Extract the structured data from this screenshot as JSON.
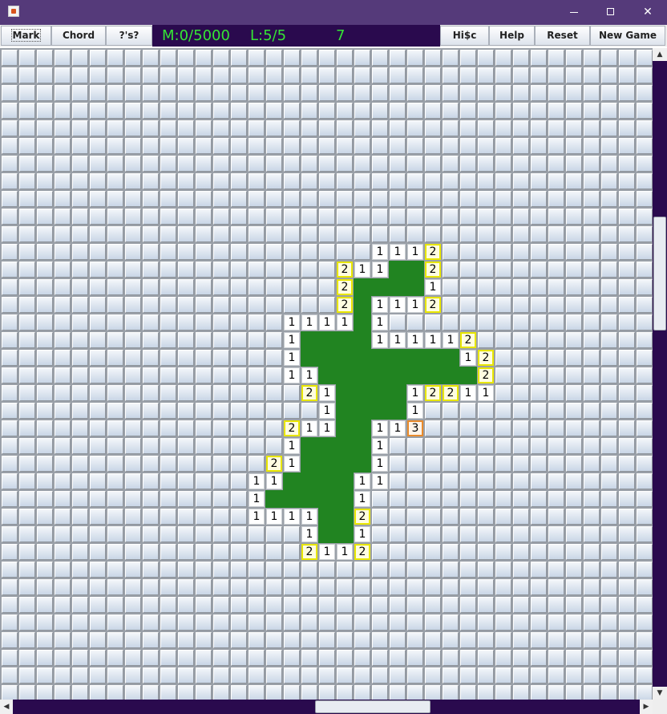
{
  "window": {
    "icon": "java-cup-icon",
    "controls": {
      "minimize": "minimize-icon",
      "maximize": "maximize-icon",
      "close": "✕"
    }
  },
  "toolbar": {
    "mark": "Mark",
    "chord": "Chord",
    "questions": "?'s?",
    "hisc": "Hi$c",
    "help": "Help",
    "reset": "Reset",
    "new_game": "New Game"
  },
  "status": {
    "mines": "M:0/5000",
    "lives": "L:5/5",
    "count": "7"
  },
  "colors": {
    "title_bar": "#553a7a",
    "status_bg": "#2a0a4e",
    "status_text": "#35e535",
    "revealed_empty": "#218421",
    "hint_border": "#e8e600",
    "hot_border": "#e88a2a"
  },
  "board": {
    "cols": 37,
    "rows": 37,
    "revealed": [
      {
        "r": 11,
        "c": 21,
        "v": "1"
      },
      {
        "r": 11,
        "c": 22,
        "v": "1"
      },
      {
        "r": 11,
        "c": 23,
        "v": "1"
      },
      {
        "r": 11,
        "c": 24,
        "v": "2",
        "s": "hint"
      },
      {
        "r": 12,
        "c": 19,
        "v": "2",
        "s": "hint"
      },
      {
        "r": 12,
        "c": 20,
        "v": "1"
      },
      {
        "r": 12,
        "c": 21,
        "v": "1"
      },
      {
        "r": 12,
        "c": 22,
        "v": ""
      },
      {
        "r": 12,
        "c": 23,
        "v": ""
      },
      {
        "r": 12,
        "c": 24,
        "v": "2",
        "s": "hint"
      },
      {
        "r": 13,
        "c": 19,
        "v": "2",
        "s": "hint"
      },
      {
        "r": 13,
        "c": 20,
        "v": ""
      },
      {
        "r": 13,
        "c": 21,
        "v": ""
      },
      {
        "r": 13,
        "c": 22,
        "v": ""
      },
      {
        "r": 13,
        "c": 23,
        "v": ""
      },
      {
        "r": 13,
        "c": 24,
        "v": "1"
      },
      {
        "r": 14,
        "c": 19,
        "v": "2",
        "s": "hint"
      },
      {
        "r": 14,
        "c": 20,
        "v": ""
      },
      {
        "r": 14,
        "c": 21,
        "v": "1"
      },
      {
        "r": 14,
        "c": 22,
        "v": "1"
      },
      {
        "r": 14,
        "c": 23,
        "v": "1"
      },
      {
        "r": 14,
        "c": 24,
        "v": "2",
        "s": "hint"
      },
      {
        "r": 15,
        "c": 16,
        "v": "1"
      },
      {
        "r": 15,
        "c": 17,
        "v": "1"
      },
      {
        "r": 15,
        "c": 18,
        "v": "1"
      },
      {
        "r": 15,
        "c": 19,
        "v": "1"
      },
      {
        "r": 15,
        "c": 20,
        "v": ""
      },
      {
        "r": 15,
        "c": 21,
        "v": "1"
      },
      {
        "r": 16,
        "c": 16,
        "v": "1"
      },
      {
        "r": 16,
        "c": 17,
        "v": ""
      },
      {
        "r": 16,
        "c": 18,
        "v": ""
      },
      {
        "r": 16,
        "c": 19,
        "v": ""
      },
      {
        "r": 16,
        "c": 20,
        "v": ""
      },
      {
        "r": 16,
        "c": 21,
        "v": "1"
      },
      {
        "r": 16,
        "c": 22,
        "v": "1"
      },
      {
        "r": 16,
        "c": 23,
        "v": "1"
      },
      {
        "r": 16,
        "c": 24,
        "v": "1"
      },
      {
        "r": 16,
        "c": 25,
        "v": "1"
      },
      {
        "r": 16,
        "c": 26,
        "v": "2",
        "s": "hint"
      },
      {
        "r": 17,
        "c": 16,
        "v": "1"
      },
      {
        "r": 17,
        "c": 17,
        "v": ""
      },
      {
        "r": 17,
        "c": 18,
        "v": ""
      },
      {
        "r": 17,
        "c": 19,
        "v": ""
      },
      {
        "r": 17,
        "c": 20,
        "v": ""
      },
      {
        "r": 17,
        "c": 21,
        "v": ""
      },
      {
        "r": 17,
        "c": 22,
        "v": ""
      },
      {
        "r": 17,
        "c": 23,
        "v": ""
      },
      {
        "r": 17,
        "c": 24,
        "v": ""
      },
      {
        "r": 17,
        "c": 25,
        "v": ""
      },
      {
        "r": 17,
        "c": 26,
        "v": "1"
      },
      {
        "r": 17,
        "c": 27,
        "v": "2",
        "s": "hint"
      },
      {
        "r": 18,
        "c": 16,
        "v": "1"
      },
      {
        "r": 18,
        "c": 17,
        "v": "1"
      },
      {
        "r": 18,
        "c": 18,
        "v": ""
      },
      {
        "r": 18,
        "c": 19,
        "v": ""
      },
      {
        "r": 18,
        "c": 20,
        "v": ""
      },
      {
        "r": 18,
        "c": 21,
        "v": ""
      },
      {
        "r": 18,
        "c": 22,
        "v": ""
      },
      {
        "r": 18,
        "c": 23,
        "v": ""
      },
      {
        "r": 18,
        "c": 24,
        "v": ""
      },
      {
        "r": 18,
        "c": 25,
        "v": ""
      },
      {
        "r": 18,
        "c": 26,
        "v": ""
      },
      {
        "r": 18,
        "c": 27,
        "v": "2",
        "s": "hint"
      },
      {
        "r": 19,
        "c": 17,
        "v": "2",
        "s": "hint"
      },
      {
        "r": 19,
        "c": 18,
        "v": "1"
      },
      {
        "r": 19,
        "c": 19,
        "v": ""
      },
      {
        "r": 19,
        "c": 20,
        "v": ""
      },
      {
        "r": 19,
        "c": 21,
        "v": ""
      },
      {
        "r": 19,
        "c": 22,
        "v": ""
      },
      {
        "r": 19,
        "c": 23,
        "v": "1"
      },
      {
        "r": 19,
        "c": 24,
        "v": "2",
        "s": "hint"
      },
      {
        "r": 19,
        "c": 25,
        "v": "2",
        "s": "hint"
      },
      {
        "r": 19,
        "c": 26,
        "v": "1"
      },
      {
        "r": 19,
        "c": 27,
        "v": "1"
      },
      {
        "r": 20,
        "c": 18,
        "v": "1"
      },
      {
        "r": 20,
        "c": 19,
        "v": ""
      },
      {
        "r": 20,
        "c": 20,
        "v": ""
      },
      {
        "r": 20,
        "c": 21,
        "v": ""
      },
      {
        "r": 20,
        "c": 22,
        "v": ""
      },
      {
        "r": 20,
        "c": 23,
        "v": "1"
      },
      {
        "r": 21,
        "c": 16,
        "v": "2",
        "s": "hint"
      },
      {
        "r": 21,
        "c": 17,
        "v": "1"
      },
      {
        "r": 21,
        "c": 18,
        "v": "1"
      },
      {
        "r": 21,
        "c": 19,
        "v": ""
      },
      {
        "r": 21,
        "c": 20,
        "v": ""
      },
      {
        "r": 21,
        "c": 21,
        "v": "1"
      },
      {
        "r": 21,
        "c": 22,
        "v": "1"
      },
      {
        "r": 21,
        "c": 23,
        "v": "3",
        "s": "hot"
      },
      {
        "r": 22,
        "c": 16,
        "v": "1"
      },
      {
        "r": 22,
        "c": 17,
        "v": ""
      },
      {
        "r": 22,
        "c": 18,
        "v": ""
      },
      {
        "r": 22,
        "c": 19,
        "v": ""
      },
      {
        "r": 22,
        "c": 20,
        "v": ""
      },
      {
        "r": 22,
        "c": 21,
        "v": "1"
      },
      {
        "r": 23,
        "c": 15,
        "v": "2",
        "s": "hint"
      },
      {
        "r": 23,
        "c": 16,
        "v": "1"
      },
      {
        "r": 23,
        "c": 17,
        "v": ""
      },
      {
        "r": 23,
        "c": 18,
        "v": ""
      },
      {
        "r": 23,
        "c": 19,
        "v": ""
      },
      {
        "r": 23,
        "c": 20,
        "v": ""
      },
      {
        "r": 23,
        "c": 21,
        "v": "1"
      },
      {
        "r": 24,
        "c": 14,
        "v": "1"
      },
      {
        "r": 24,
        "c": 15,
        "v": "1"
      },
      {
        "r": 24,
        "c": 16,
        "v": ""
      },
      {
        "r": 24,
        "c": 17,
        "v": ""
      },
      {
        "r": 24,
        "c": 18,
        "v": ""
      },
      {
        "r": 24,
        "c": 19,
        "v": ""
      },
      {
        "r": 24,
        "c": 20,
        "v": "1"
      },
      {
        "r": 24,
        "c": 21,
        "v": "1"
      },
      {
        "r": 25,
        "c": 14,
        "v": "1"
      },
      {
        "r": 25,
        "c": 15,
        "v": ""
      },
      {
        "r": 25,
        "c": 16,
        "v": ""
      },
      {
        "r": 25,
        "c": 17,
        "v": ""
      },
      {
        "r": 25,
        "c": 18,
        "v": ""
      },
      {
        "r": 25,
        "c": 19,
        "v": ""
      },
      {
        "r": 25,
        "c": 20,
        "v": "1"
      },
      {
        "r": 26,
        "c": 14,
        "v": "1"
      },
      {
        "r": 26,
        "c": 15,
        "v": "1"
      },
      {
        "r": 26,
        "c": 16,
        "v": "1"
      },
      {
        "r": 26,
        "c": 17,
        "v": "1"
      },
      {
        "r": 26,
        "c": 18,
        "v": ""
      },
      {
        "r": 26,
        "c": 19,
        "v": ""
      },
      {
        "r": 26,
        "c": 20,
        "v": "2",
        "s": "hint"
      },
      {
        "r": 27,
        "c": 17,
        "v": "1"
      },
      {
        "r": 27,
        "c": 18,
        "v": ""
      },
      {
        "r": 27,
        "c": 19,
        "v": ""
      },
      {
        "r": 27,
        "c": 20,
        "v": "1"
      },
      {
        "r": 28,
        "c": 17,
        "v": "2",
        "s": "hint"
      },
      {
        "r": 28,
        "c": 18,
        "v": "1"
      },
      {
        "r": 28,
        "c": 19,
        "v": "1"
      },
      {
        "r": 28,
        "c": 20,
        "v": "2",
        "s": "hint"
      }
    ]
  }
}
